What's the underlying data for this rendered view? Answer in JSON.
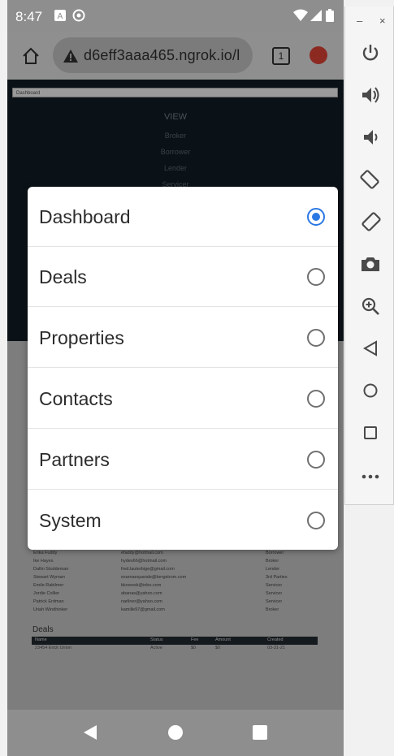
{
  "status_bar": {
    "time": "8:47"
  },
  "browser": {
    "url": "d6eff3aaa465.ngrok.io/l",
    "tab_count": "1"
  },
  "page": {
    "select_value": "Dashboard",
    "nav": {
      "view": "VIEW",
      "items": [
        "Broker",
        "Borrower",
        "Lender",
        "Servicer"
      ]
    },
    "contacts": [
      {
        "name": "Erika Fuddy",
        "email": "efaddy@hotmail.com",
        "role": "Borrower"
      },
      {
        "name": "Ike Hayes",
        "email": "hydes66@hotmail.com",
        "role": "Broker"
      },
      {
        "name": "Dallin Stoddeman",
        "email": "fred.lauterbige@gmail.com",
        "role": "Lender"
      },
      {
        "name": "Stewart Wyman",
        "email": "examaequande@bergstrom.com",
        "role": "3rd Parties"
      },
      {
        "name": "Emile Rabilmer",
        "email": "bkowosk@inbo.com",
        "role": "Servicer"
      },
      {
        "name": "Jordie Collier",
        "email": "abanas@yahoo.com",
        "role": "Servicer"
      },
      {
        "name": "Patrick Erdman",
        "email": "narliner@yahoo.com",
        "role": "Servicer"
      },
      {
        "name": "Uriah Windhinker",
        "email": "kamille97@gmail.com",
        "role": "Broker"
      }
    ],
    "deals_heading": "Deals",
    "deals_columns": [
      "Name",
      "Status",
      "Fee",
      "Amount",
      "Created"
    ],
    "deals_rows": [
      {
        "name": "23454 Erick Union",
        "status": "Active",
        "fee": "$0",
        "amount": "$0",
        "created": "03-31-21"
      }
    ]
  },
  "dialog": {
    "options": [
      {
        "label": "Dashboard",
        "selected": true
      },
      {
        "label": "Deals",
        "selected": false
      },
      {
        "label": "Properties",
        "selected": false
      },
      {
        "label": "Contacts",
        "selected": false
      },
      {
        "label": "Partners",
        "selected": false
      },
      {
        "label": "System",
        "selected": false
      }
    ]
  },
  "emulator": {
    "minimize": "–",
    "close": "×",
    "buttons": [
      "power-icon",
      "volume-up-icon",
      "volume-down-icon",
      "rotate-left-icon",
      "rotate-right-icon",
      "camera-icon",
      "zoom-icon",
      "back-icon",
      "home-icon",
      "overview-icon",
      "more-icon"
    ]
  }
}
